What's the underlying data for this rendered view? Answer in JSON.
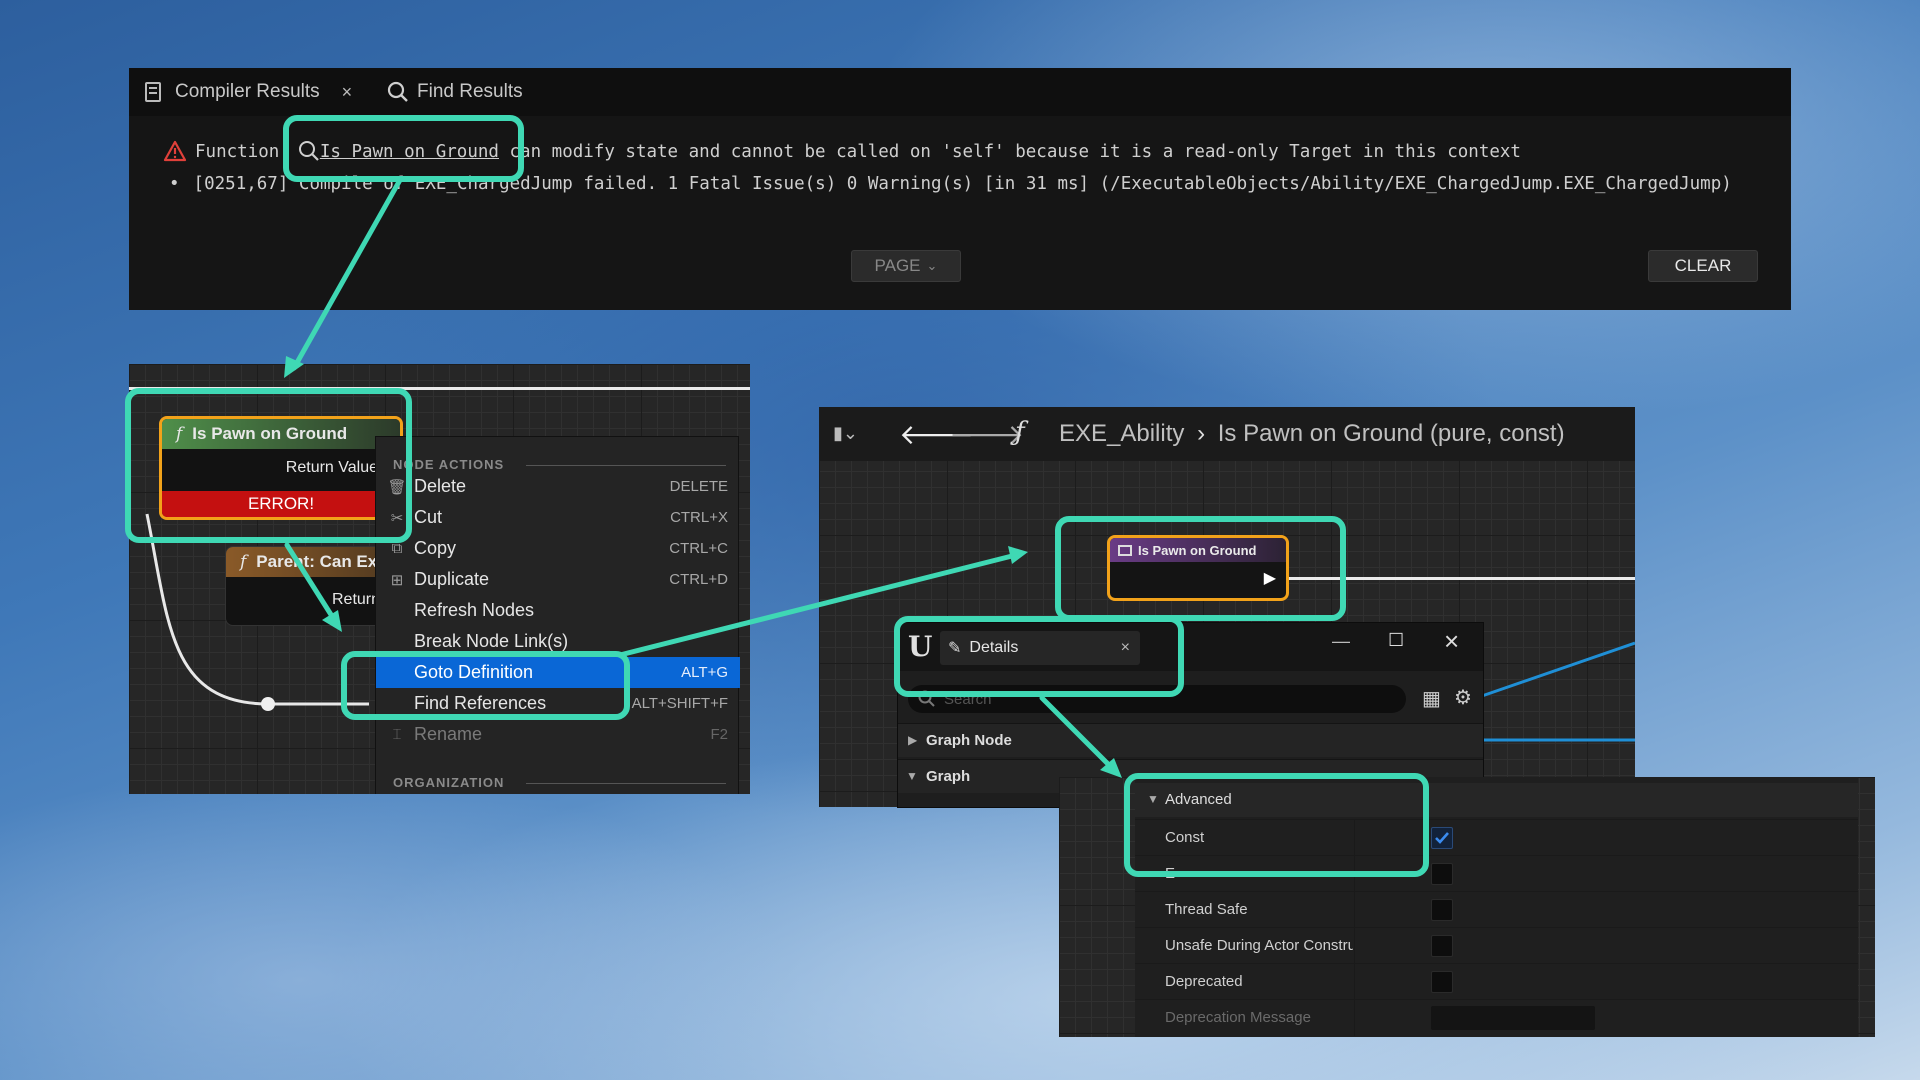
{
  "compiler": {
    "tab_compiler": "Compiler Results",
    "tab_find": "Find Results",
    "error_prefix": "Function",
    "error_link": "Is Pawn on Ground",
    "error_suffix": "can modify state and cannot be called on 'self' because it is a read-only Target in this context",
    "bullet_line": "[0251,67] Compile of EXE_ChargedJump failed. 1 Fatal Issue(s) 0 Warning(s) [in 31 ms] (/ExecutableObjects/Ability/EXE_ChargedJump.EXE_ChargedJump)",
    "page_button": "PAGE",
    "clear_button": "CLEAR"
  },
  "left_graph": {
    "node1_title": "Is Pawn on Ground",
    "node1_pin": "Return Value",
    "node1_error": "ERROR!",
    "node2_title": "Parent: Can Ex",
    "node2_pin": "Return"
  },
  "context_menu": {
    "section_node_actions": "NODE ACTIONS",
    "section_organization": "ORGANIZATION",
    "items": [
      {
        "label": "Delete",
        "shortcut": "DELETE"
      },
      {
        "label": "Cut",
        "shortcut": "CTRL+X"
      },
      {
        "label": "Copy",
        "shortcut": "CTRL+C"
      },
      {
        "label": "Duplicate",
        "shortcut": "CTRL+D"
      },
      {
        "label": "Refresh Nodes",
        "shortcut": ""
      },
      {
        "label": "Break Node Link(s)",
        "shortcut": ""
      },
      {
        "label": "Goto Definition",
        "shortcut": "ALT+G"
      },
      {
        "label": "Find References",
        "shortcut": "ALT+SHIFT+F"
      },
      {
        "label": "Rename",
        "shortcut": "F2"
      }
    ]
  },
  "right_graph": {
    "crumb_root": "EXE_Ability",
    "crumb_current": "Is Pawn on Ground (pure, const)",
    "node_title": "Is Pawn on Ground"
  },
  "details": {
    "tab_label": "Details",
    "search_placeholder": "Search",
    "section_graph_node": "Graph Node",
    "section_graph": "Graph",
    "section_advanced": "Advanced",
    "rows": [
      {
        "label": "Const",
        "checked": true
      },
      {
        "label": "E",
        "checked": false
      },
      {
        "label": "Thread Safe",
        "checked": false
      },
      {
        "label": "Unsafe During Actor Constru",
        "checked": false
      },
      {
        "label": "Deprecated",
        "checked": false
      },
      {
        "label": "Deprecation Message",
        "checked": null
      }
    ]
  },
  "colors": {
    "highlight": "#3fd8b4",
    "selection_blue": "#0a67d6",
    "error_red": "#c41010",
    "node_orange": "#f2a21a"
  }
}
